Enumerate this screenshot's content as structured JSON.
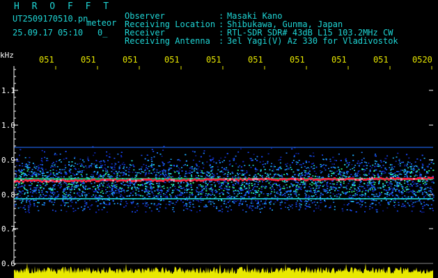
{
  "header": {
    "title": "H R O F F T",
    "filename": "UT2509170510.pn",
    "capture_type": "meteor",
    "timestamp": "25.09.17 05:10",
    "count": "0_"
  },
  "station_info": [
    {
      "label": "Observer",
      "value": "Masaki Kano"
    },
    {
      "label": "Receiving Location",
      "value": "Shibukawa, Gunma, Japan"
    },
    {
      "label": "Receiver",
      "value": "RTL-SDR SDR# 43dB L15 103.2MHz CW"
    },
    {
      "label": "Receiving Antenna",
      "value": "3el Yagi(V) Az 330 for Vladivostok"
    }
  ],
  "separator": ":",
  "axis": {
    "y_unit": "kHz",
    "y_ticks": [
      "1.1",
      "1.0",
      "0.9",
      "0.8",
      "0.7",
      "0.6"
    ],
    "x_ticks": [
      "051",
      "051",
      "051",
      "051",
      "051",
      "051",
      "051",
      "051",
      "051",
      "0520"
    ]
  },
  "colors": {
    "cyan": "#1fd6d6",
    "yellow": "#e8e800",
    "signal_red": "#ff2040",
    "noise_blue": "#1a3cff"
  }
}
